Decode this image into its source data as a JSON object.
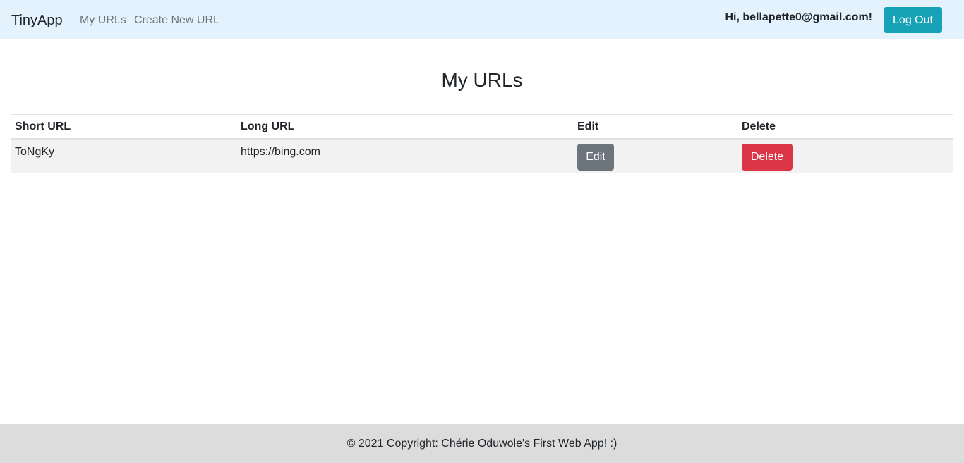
{
  "navbar": {
    "brand": "TinyApp",
    "links": [
      "My URLs",
      "Create New URL"
    ],
    "greeting": "Hi, bellapette0@gmail.com!",
    "logout_label": "Log Out"
  },
  "main": {
    "title": "My URLs",
    "table": {
      "headers": [
        "Short URL",
        "Long URL",
        "Edit",
        "Delete"
      ],
      "rows": [
        {
          "short_url": "ToNgKy",
          "long_url": "https://bing.com",
          "edit_label": "Edit",
          "delete_label": "Delete"
        }
      ]
    }
  },
  "footer": {
    "text": "© 2021 Copyright: Chérie Oduwole's First Web App! :)"
  },
  "colors": {
    "navbar_bg": "#e3f2fd",
    "logout_button": "#17a2b8",
    "edit_button": "#6c757d",
    "delete_button": "#dc3545",
    "footer_bg": "#dcdcdc",
    "row_bg": "#f2f2f2"
  }
}
